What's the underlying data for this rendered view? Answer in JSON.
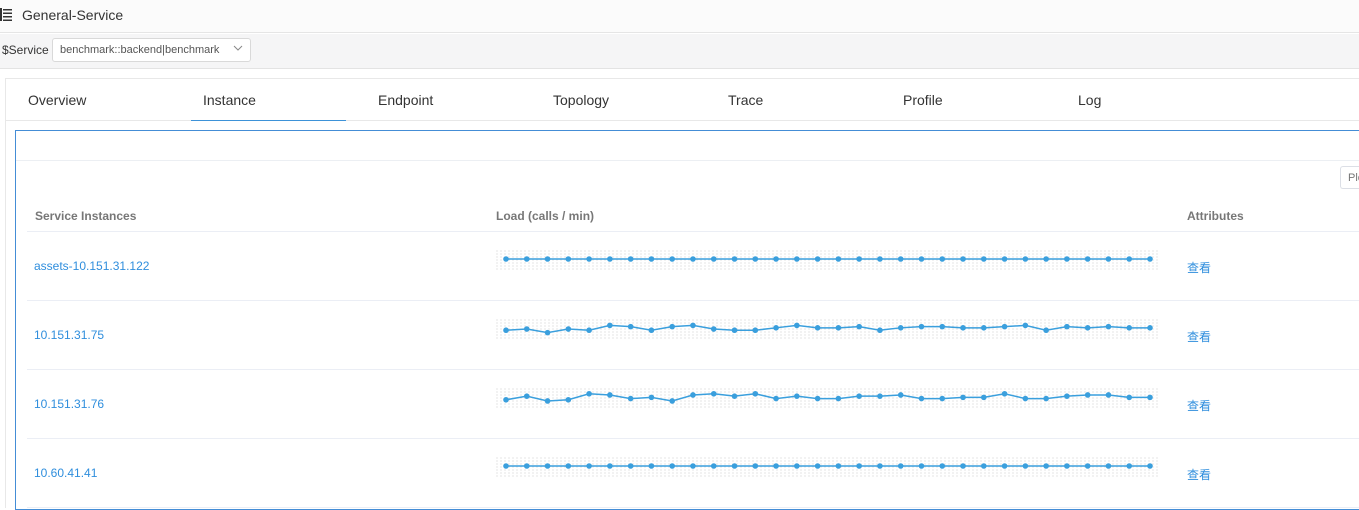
{
  "header": {
    "title": "General-Service",
    "menu_icon": "list-icon"
  },
  "filter": {
    "label": "$Service",
    "selected_value": "benchmark::backend|benchmark",
    "chevron_icon": "chevron-down-icon"
  },
  "tabs": [
    {
      "label": "Overview",
      "active": false
    },
    {
      "label": "Instance",
      "active": true
    },
    {
      "label": "Endpoint",
      "active": false
    },
    {
      "label": "Topology",
      "active": false
    },
    {
      "label": "Trace",
      "active": false
    },
    {
      "label": "Profile",
      "active": false
    },
    {
      "label": "Log",
      "active": false
    }
  ],
  "search": {
    "placeholder": "Please enter"
  },
  "table": {
    "columns": [
      "Service Instances",
      "Load (calls / min)",
      "Attributes"
    ],
    "rows": [
      {
        "name": "assets-10.151.31.122",
        "attribute_link": "查看",
        "load": [
          0,
          0,
          0,
          0,
          0,
          0,
          0,
          0,
          0,
          0,
          0,
          0,
          0,
          0,
          0,
          0,
          0,
          0,
          0,
          0,
          0,
          0,
          0,
          0,
          0,
          0,
          0,
          0,
          0,
          0,
          0,
          0
        ]
      },
      {
        "name": "10.151.31.75",
        "attribute_link": "查看",
        "load": [
          3,
          4,
          1,
          4,
          3,
          7,
          6,
          3,
          6,
          7,
          4,
          3,
          3,
          5,
          7,
          5,
          5,
          6,
          3,
          5,
          6,
          6,
          5,
          5,
          6,
          7,
          3,
          6,
          5,
          6,
          5,
          5
        ]
      },
      {
        "name": "10.151.31.76",
        "attribute_link": "查看",
        "load": [
          2,
          5,
          1,
          2,
          7,
          6,
          3,
          4,
          1,
          6,
          7,
          5,
          7,
          3,
          5,
          3,
          3,
          5,
          5,
          6,
          3,
          3,
          4,
          4,
          7,
          3,
          3,
          5,
          6,
          6,
          4,
          4
        ]
      },
      {
        "name": "10.60.41.41",
        "attribute_link": "查看",
        "load": [
          0,
          0,
          0,
          0,
          0,
          0,
          0,
          0,
          0,
          0,
          0,
          0,
          0,
          0,
          0,
          0,
          0,
          0,
          0,
          0,
          0,
          0,
          0,
          0,
          0,
          0,
          0,
          0,
          0,
          0,
          0,
          0
        ]
      }
    ]
  },
  "colors": {
    "accent": "#3d92d8",
    "link": "#2f8edd",
    "spark_line": "#3a9fdd",
    "grid": "#e6e6e6"
  }
}
